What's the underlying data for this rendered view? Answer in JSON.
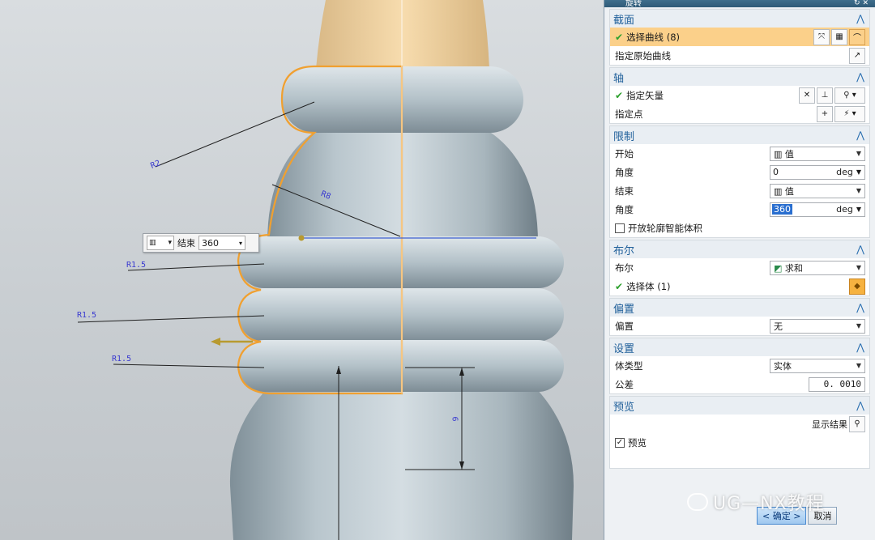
{
  "dialog": {
    "title": "旋转",
    "sections": {
      "section": {
        "title": "截面",
        "select_curve": "选择曲线 (8)",
        "origin_curve": "指定原始曲线"
      },
      "axis": {
        "title": "轴",
        "vector": "指定矢量",
        "point": "指定点"
      },
      "limits": {
        "title": "限制",
        "start_label": "开始",
        "start_type": "值",
        "angle1_label": "角度",
        "angle1_value": "0",
        "angle1_unit": "deg",
        "end_label": "结束",
        "end_type": "值",
        "angle2_label": "角度",
        "angle2_value": "360",
        "angle2_unit": "deg",
        "open_profile": "开放轮廓智能体积"
      },
      "boolean": {
        "title": "布尔",
        "label": "布尔",
        "value": "求和",
        "select_body": "选择体 (1)"
      },
      "offset": {
        "title": "偏置",
        "label": "偏置",
        "value": "无"
      },
      "settings": {
        "title": "设置",
        "body_type_label": "体类型",
        "body_type_value": "实体",
        "tolerance_label": "公差",
        "tolerance_value": "0. 0010"
      },
      "preview": {
        "title": "预览",
        "show_result": "显示结果",
        "preview_label": "预览"
      }
    },
    "buttons": {
      "ok": "< 确定 >",
      "cancel": "取消"
    }
  },
  "viewport": {
    "float_field": {
      "label": "结束",
      "value": "360"
    },
    "dimensions": {
      "r_top": "R2",
      "r_mid": "R8",
      "r_a": "R1.5",
      "r_b": "R1.5",
      "r_c": "R1.5",
      "height": "6"
    }
  },
  "watermark": "UG—NX教程",
  "colors": {
    "accent": "#1f5f9a",
    "highlight": "#fbd08a",
    "body": "#a9b7bf",
    "curve": "#f0a030"
  }
}
